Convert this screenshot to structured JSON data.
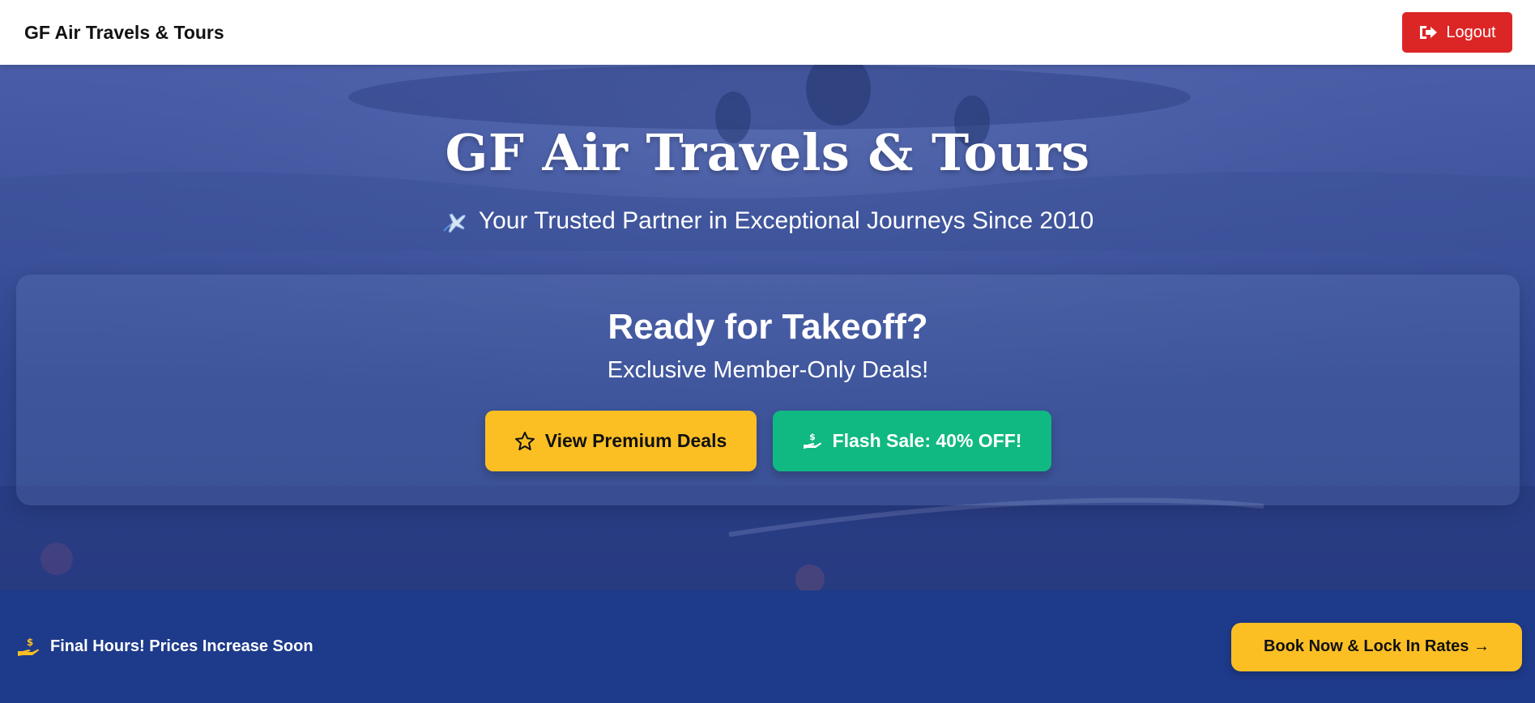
{
  "header": {
    "brand": "GF Air Travels & Tours",
    "logout_label": "Logout",
    "logout_icon": "sign-out-icon"
  },
  "hero": {
    "title": "GF Air Travels & Tours",
    "subtitle_icon": "airplane-icon",
    "subtitle": "Your Trusted Partner in Exceptional Journeys Since 2010"
  },
  "promo": {
    "title": "Ready for Takeoff?",
    "subtitle": "Exclusive Member-Only Deals!",
    "premium_label": "View Premium Deals",
    "premium_icon": "star-icon",
    "flash_label": "Flash Sale: 40% OFF!",
    "flash_icon": "hand-dollar-icon"
  },
  "bottom": {
    "urgent_icon": "hand-dollar-icon",
    "urgent_text": "Final Hours! Prices Increase Soon",
    "book_label": "Book Now & Lock In Rates →"
  },
  "colors": {
    "header_bg": "#ffffff",
    "logout": "#dc2626",
    "hero_blue": "#3e539c",
    "navy": "#1e3a8a",
    "yellow": "#fbbf24",
    "green": "#10b981"
  }
}
